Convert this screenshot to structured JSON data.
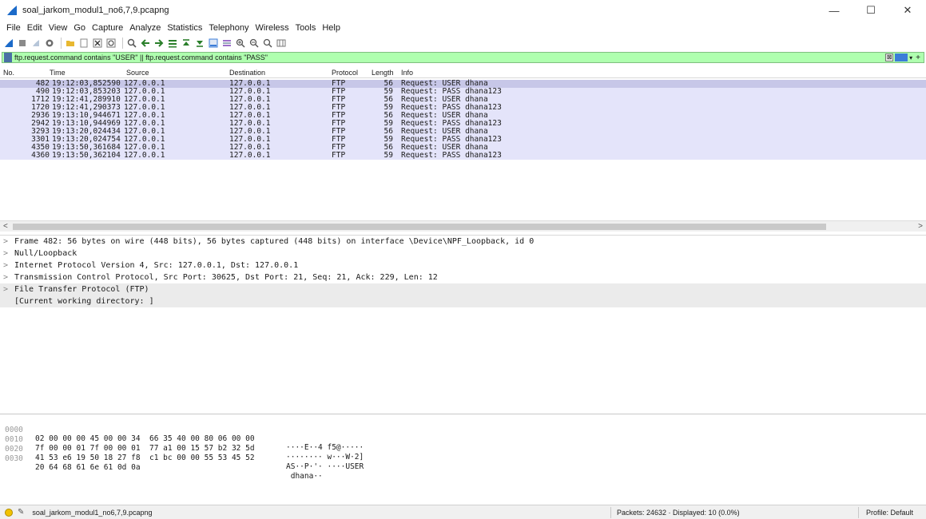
{
  "window": {
    "title": "soal_jarkom_modul1_no6,7,9.pcapng",
    "minimize": "—",
    "maximize": "☐",
    "close": "✕"
  },
  "menu": [
    "File",
    "Edit",
    "View",
    "Go",
    "Capture",
    "Analyze",
    "Statistics",
    "Telephony",
    "Wireless",
    "Tools",
    "Help"
  ],
  "filter": {
    "value": "ftp.request.command contains \"USER\" || ftp.request.command contains \"PASS\"",
    "clear": "⊠",
    "dropdown": "▾",
    "add": "+"
  },
  "packet_list": {
    "columns": {
      "no": "No.",
      "time": "Time",
      "source": "Source",
      "destination": "Destination",
      "protocol": "Protocol",
      "length": "Length",
      "info": "Info"
    },
    "rows": [
      {
        "no": "482",
        "time": "19:12:03,852590",
        "source": "127.0.0.1",
        "destination": "127.0.0.1",
        "protocol": "FTP",
        "length": "56",
        "info": "Request: USER dhana"
      },
      {
        "no": "490",
        "time": "19:12:03,853203",
        "source": "127.0.0.1",
        "destination": "127.0.0.1",
        "protocol": "FTP",
        "length": "59",
        "info": "Request: PASS dhana123"
      },
      {
        "no": "1712",
        "time": "19:12:41,289910",
        "source": "127.0.0.1",
        "destination": "127.0.0.1",
        "protocol": "FTP",
        "length": "56",
        "info": "Request: USER dhana"
      },
      {
        "no": "1720",
        "time": "19:12:41,290373",
        "source": "127.0.0.1",
        "destination": "127.0.0.1",
        "protocol": "FTP",
        "length": "59",
        "info": "Request: PASS dhana123"
      },
      {
        "no": "2936",
        "time": "19:13:10,944671",
        "source": "127.0.0.1",
        "destination": "127.0.0.1",
        "protocol": "FTP",
        "length": "56",
        "info": "Request: USER dhana"
      },
      {
        "no": "2942",
        "time": "19:13:10,944969",
        "source": "127.0.0.1",
        "destination": "127.0.0.1",
        "protocol": "FTP",
        "length": "59",
        "info": "Request: PASS dhana123"
      },
      {
        "no": "3293",
        "time": "19:13:20,024434",
        "source": "127.0.0.1",
        "destination": "127.0.0.1",
        "protocol": "FTP",
        "length": "56",
        "info": "Request: USER dhana"
      },
      {
        "no": "3301",
        "time": "19:13:20,024754",
        "source": "127.0.0.1",
        "destination": "127.0.0.1",
        "protocol": "FTP",
        "length": "59",
        "info": "Request: PASS dhana123"
      },
      {
        "no": "4350",
        "time": "19:13:50,361684",
        "source": "127.0.0.1",
        "destination": "127.0.0.1",
        "protocol": "FTP",
        "length": "56",
        "info": "Request: USER dhana"
      },
      {
        "no": "4360",
        "time": "19:13:50,362104",
        "source": "127.0.0.1",
        "destination": "127.0.0.1",
        "protocol": "FTP",
        "length": "59",
        "info": "Request: PASS dhana123"
      }
    ]
  },
  "scroll": {
    "left": "<",
    "right": ">"
  },
  "details": [
    {
      "arrow": ">",
      "text": "Frame 482: 56 bytes on wire (448 bits), 56 bytes captured (448 bits) on interface \\Device\\NPF_Loopback, id 0"
    },
    {
      "arrow": ">",
      "text": "Null/Loopback"
    },
    {
      "arrow": ">",
      "text": "Internet Protocol Version 4, Src: 127.0.0.1, Dst: 127.0.0.1"
    },
    {
      "arrow": ">",
      "text": "Transmission Control Protocol, Src Port: 30625, Dst Port: 21, Seq: 21, Ack: 229, Len: 12"
    },
    {
      "arrow": ">",
      "text": "File Transfer Protocol (FTP)"
    },
    {
      "arrow": "",
      "text": "[Current working directory: ]"
    }
  ],
  "bytes": [
    {
      "offset": "0000",
      "hex": "02 00 00 00 45 00 00 34  66 35 40 00 80 06 00 00",
      "ascii": "····E··4 f5@·····"
    },
    {
      "offset": "0010",
      "hex": "7f 00 00 01 7f 00 00 01  77 a1 00 15 57 b2 32 5d",
      "ascii": "········ w···W·2]"
    },
    {
      "offset": "0020",
      "hex": "41 53 e6 19 50 18 27 f8  c1 bc 00 00 55 53 45 52",
      "ascii": "AS··P·'· ····USER"
    },
    {
      "offset": "0030",
      "hex": "20 64 68 61 6e 61 0d 0a",
      "ascii": " dhana··"
    }
  ],
  "status": {
    "file": "soal_jarkom_modul1_no6,7,9.pcapng",
    "packets": "Packets: 24632 · Displayed: 10 (0.0%)",
    "profile": "Profile: Default"
  },
  "colors": {
    "filter_valid": "#afffaf",
    "row_bg": "#e4e4fa",
    "row_selected": "#c7c7e8"
  }
}
